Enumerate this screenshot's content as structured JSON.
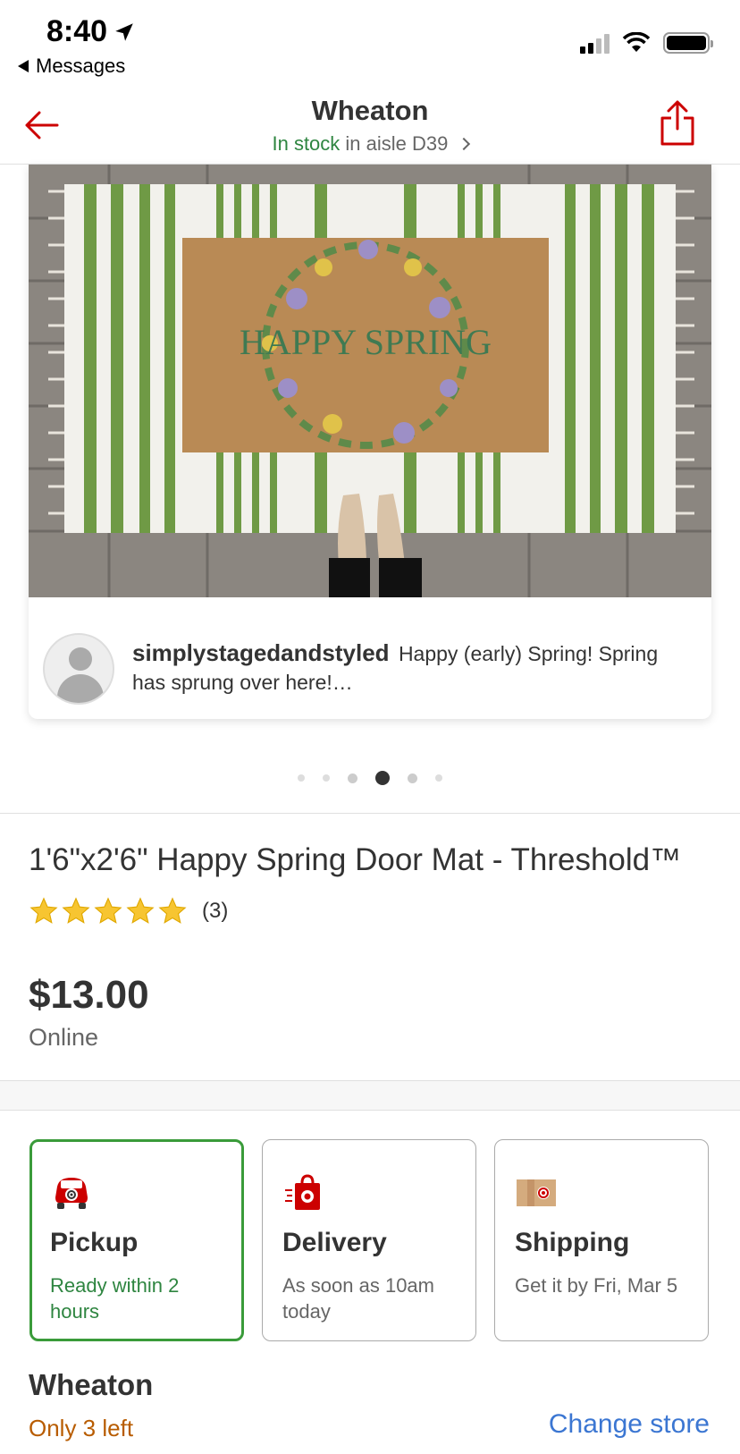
{
  "status_bar": {
    "time": "8:40",
    "back_app": "Messages"
  },
  "header": {
    "store": "Wheaton",
    "stock_status": "In stock",
    "aisle_text": "in aisle D39"
  },
  "carousel": {
    "image_text": "HAPPY SPRING",
    "review": {
      "username": "simplystagedandstyled",
      "text": "Happy (early) Spring!  Spring has sprung over here!…"
    },
    "dots_count": 6,
    "active_dot": 4
  },
  "product": {
    "title": "1'6\"x2'6\" Happy Spring Door Mat - Threshold™",
    "rating": 5,
    "rating_count": "(3)",
    "price": "$13.00",
    "price_label": "Online"
  },
  "fulfillment": [
    {
      "title": "Pickup",
      "sub": "Ready within 2 hours",
      "selected": true,
      "icon": "pickup-car-icon"
    },
    {
      "title": "Delivery",
      "sub": "As soon as 10am today",
      "selected": false,
      "icon": "delivery-bag-icon"
    },
    {
      "title": "Shipping",
      "sub": "Get it by Fri, Mar 5",
      "selected": false,
      "icon": "shipping-box-icon"
    }
  ],
  "store_section": {
    "name": "Wheaton",
    "stock": "Only 3 left",
    "change_store": "Change store"
  },
  "colors": {
    "brand_red": "#cc0000",
    "in_stock_green": "#2e8540",
    "link_blue": "#3b76d2",
    "low_stock_orange": "#b85c00"
  }
}
